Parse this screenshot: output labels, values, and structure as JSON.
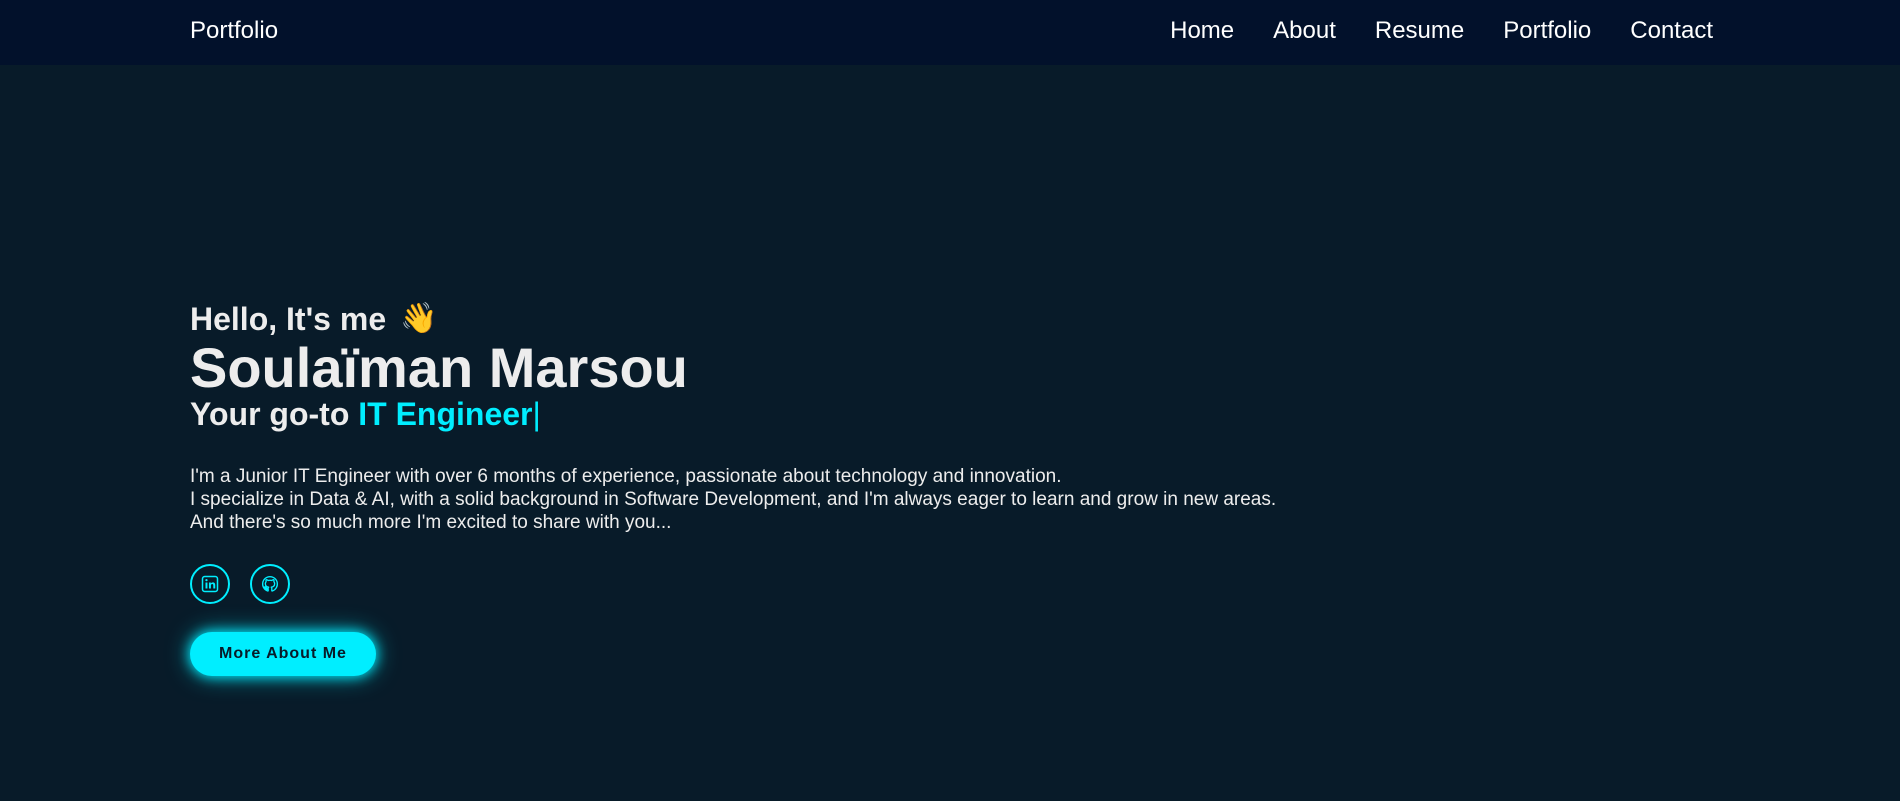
{
  "navbar": {
    "logo": "Portfolio",
    "links": [
      "Home",
      "About",
      "Resume",
      "Portfolio",
      "Contact"
    ]
  },
  "hero": {
    "greeting": "Hello, It's me",
    "wave_emoji": "👋",
    "name": "Soulaïman Marsou",
    "tagline_prefix": "Your go-to ",
    "role": "IT Engineer",
    "cursor": "|",
    "description": [
      "I'm a Junior IT Engineer with over 6 months of experience, passionate about technology and innovation.",
      "I specialize in Data & AI, with a solid background in Software Development, and I'm always eager to learn and grow in new areas.",
      "And there's so much more I'm excited to share with you..."
    ],
    "socials": [
      {
        "icon": "linkedin-icon"
      },
      {
        "icon": "github-icon"
      }
    ],
    "cta_label": "More About Me"
  },
  "colors": {
    "background": "#081b29",
    "navbar": "#02112b",
    "accent": "#00eeff",
    "text": "#ededed"
  }
}
